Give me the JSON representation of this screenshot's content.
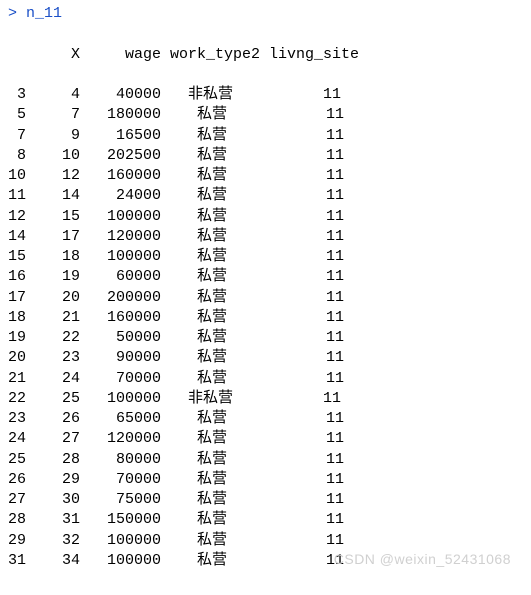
{
  "prompt": "> n_11",
  "headers": {
    "rowname": "",
    "X": "X",
    "wage": "wage",
    "work_type2": "work_type2",
    "livng_site": "livng_site"
  },
  "rows": [
    {
      "rn": "3",
      "X": "4",
      "wage": "40000",
      "wt": "非私营",
      "ls": "11"
    },
    {
      "rn": "5",
      "X": "7",
      "wage": "180000",
      "wt": "私营",
      "ls": "11"
    },
    {
      "rn": "7",
      "X": "9",
      "wage": "16500",
      "wt": "私营",
      "ls": "11"
    },
    {
      "rn": "8",
      "X": "10",
      "wage": "202500",
      "wt": "私营",
      "ls": "11"
    },
    {
      "rn": "10",
      "X": "12",
      "wage": "160000",
      "wt": "私营",
      "ls": "11"
    },
    {
      "rn": "11",
      "X": "14",
      "wage": "24000",
      "wt": "私营",
      "ls": "11"
    },
    {
      "rn": "12",
      "X": "15",
      "wage": "100000",
      "wt": "私营",
      "ls": "11"
    },
    {
      "rn": "14",
      "X": "17",
      "wage": "120000",
      "wt": "私营",
      "ls": "11"
    },
    {
      "rn": "15",
      "X": "18",
      "wage": "100000",
      "wt": "私营",
      "ls": "11"
    },
    {
      "rn": "16",
      "X": "19",
      "wage": "60000",
      "wt": "私营",
      "ls": "11"
    },
    {
      "rn": "17",
      "X": "20",
      "wage": "200000",
      "wt": "私营",
      "ls": "11"
    },
    {
      "rn": "18",
      "X": "21",
      "wage": "160000",
      "wt": "私营",
      "ls": "11"
    },
    {
      "rn": "19",
      "X": "22",
      "wage": "50000",
      "wt": "私营",
      "ls": "11"
    },
    {
      "rn": "20",
      "X": "23",
      "wage": "90000",
      "wt": "私营",
      "ls": "11"
    },
    {
      "rn": "21",
      "X": "24",
      "wage": "70000",
      "wt": "私营",
      "ls": "11"
    },
    {
      "rn": "22",
      "X": "25",
      "wage": "100000",
      "wt": "非私营",
      "ls": "11"
    },
    {
      "rn": "23",
      "X": "26",
      "wage": "65000",
      "wt": "私营",
      "ls": "11"
    },
    {
      "rn": "24",
      "X": "27",
      "wage": "120000",
      "wt": "私营",
      "ls": "11"
    },
    {
      "rn": "25",
      "X": "28",
      "wage": "80000",
      "wt": "私营",
      "ls": "11"
    },
    {
      "rn": "26",
      "X": "29",
      "wage": "70000",
      "wt": "私营",
      "ls": "11"
    },
    {
      "rn": "27",
      "X": "30",
      "wage": "75000",
      "wt": "私营",
      "ls": "11"
    },
    {
      "rn": "28",
      "X": "31",
      "wage": "150000",
      "wt": "私营",
      "ls": "11"
    },
    {
      "rn": "29",
      "X": "32",
      "wage": "100000",
      "wt": "私营",
      "ls": "11"
    },
    {
      "rn": "31",
      "X": "34",
      "wage": "100000",
      "wt": "私营",
      "ls": "11"
    }
  ],
  "watermark": "CSDN @weixin_52431068"
}
